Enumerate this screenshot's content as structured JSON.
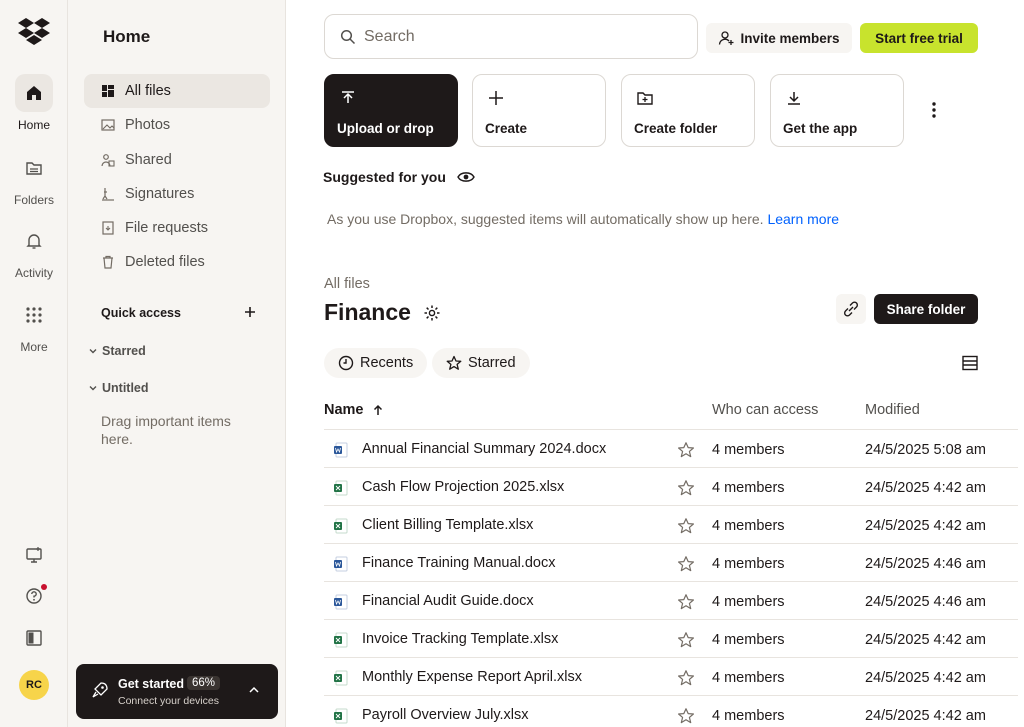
{
  "rail": {
    "items": [
      {
        "label": "Home",
        "icon": "home-icon"
      },
      {
        "label": "Folders",
        "icon": "folder-icon"
      },
      {
        "label": "Activity",
        "icon": "bell-icon"
      },
      {
        "label": "More",
        "icon": "grid-icon"
      }
    ],
    "avatar_initials": "RC"
  },
  "sidebar": {
    "title": "Home",
    "items": [
      {
        "label": "All files",
        "icon": "files-icon"
      },
      {
        "label": "Photos",
        "icon": "photo-icon"
      },
      {
        "label": "Shared",
        "icon": "shared-icon"
      },
      {
        "label": "Signatures",
        "icon": "signature-icon"
      },
      {
        "label": "File requests",
        "icon": "file-request-icon"
      },
      {
        "label": "Deleted files",
        "icon": "trash-icon"
      }
    ],
    "quick_access": "Quick access",
    "groups": [
      "Starred",
      "Untitled"
    ],
    "drag_hint": "Drag important items here.",
    "get_started": {
      "title": "Get started",
      "percent": "66%",
      "subtitle": "Connect your devices"
    }
  },
  "header": {
    "search_placeholder": "Search",
    "invite_label": "Invite members",
    "trial_label": "Start free trial"
  },
  "actions": [
    {
      "label": "Upload or drop",
      "icon": "upload-icon"
    },
    {
      "label": "Create",
      "icon": "plus-icon"
    },
    {
      "label": "Create folder",
      "icon": "folder-plus-icon"
    },
    {
      "label": "Get the app",
      "icon": "download-icon"
    }
  ],
  "suggested": {
    "title": "Suggested for you",
    "message": "As you use Dropbox, suggested items will automatically show up here.",
    "link": "Learn more"
  },
  "folder": {
    "breadcrumb": "All files",
    "title": "Finance",
    "share_label": "Share folder"
  },
  "filters": {
    "recents": "Recents",
    "starred": "Starred"
  },
  "table": {
    "headers": {
      "name": "Name",
      "access": "Who can access",
      "modified": "Modified"
    },
    "rows": [
      {
        "name": "Annual Financial Summary 2024.docx",
        "type": "word",
        "access": "4 members",
        "modified": "24/5/2025 5:08 am"
      },
      {
        "name": "Cash Flow Projection 2025.xlsx",
        "type": "excel",
        "access": "4 members",
        "modified": "24/5/2025 4:42 am"
      },
      {
        "name": "Client Billing Template.xlsx",
        "type": "excel",
        "access": "4 members",
        "modified": "24/5/2025 4:42 am"
      },
      {
        "name": "Finance Training Manual.docx",
        "type": "word",
        "access": "4 members",
        "modified": "24/5/2025 4:46 am"
      },
      {
        "name": "Financial Audit Guide.docx",
        "type": "word",
        "access": "4 members",
        "modified": "24/5/2025 4:46 am"
      },
      {
        "name": "Invoice Tracking Template.xlsx",
        "type": "excel",
        "access": "4 members",
        "modified": "24/5/2025 4:42 am"
      },
      {
        "name": "Monthly Expense Report April.xlsx",
        "type": "excel",
        "access": "4 members",
        "modified": "24/5/2025 4:42 am"
      },
      {
        "name": "Payroll Overview July.xlsx",
        "type": "excel",
        "access": "4 members",
        "modified": "24/5/2025 4:42 am"
      }
    ]
  },
  "colors": {
    "accent": "#c8e32d",
    "link": "#0061fe",
    "dark": "#1e1919",
    "word": "#2b579a",
    "excel": "#217346"
  }
}
